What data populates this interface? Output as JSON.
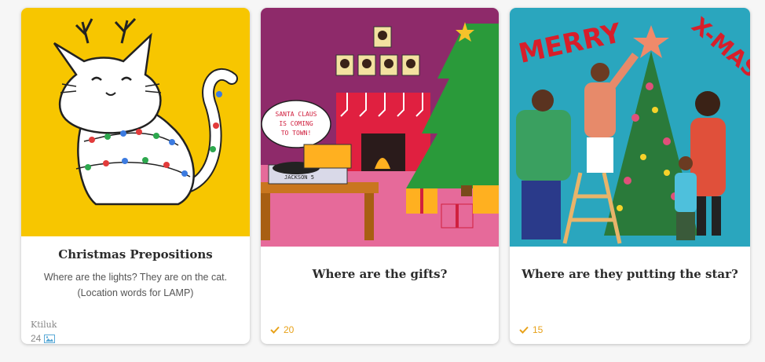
{
  "cards": [
    {
      "title": "Christmas Prepositions",
      "description_line1": "Where are the lights? They are on the cat.",
      "description_line2": "(Location words for LAMP)",
      "author": "Ktiluk",
      "image_count": "24",
      "image_bg": "#f7c600"
    },
    {
      "title": "Where are the gifts?",
      "likes": "20",
      "image_bg": "#8e2a6a",
      "speech_bubble": [
        "SANTA CLAUS",
        "IS COMING",
        "TO TOWN!"
      ],
      "record_label": "JACKSON 5"
    },
    {
      "title": "Where are they putting the star?",
      "likes": "15",
      "image_bg": "#2aa6be",
      "banner_left": "MERRY",
      "banner_right": "X-MAS"
    }
  ],
  "colors": {
    "like_accent": "#e8a21a",
    "image_icon": "#5aa9d6"
  }
}
